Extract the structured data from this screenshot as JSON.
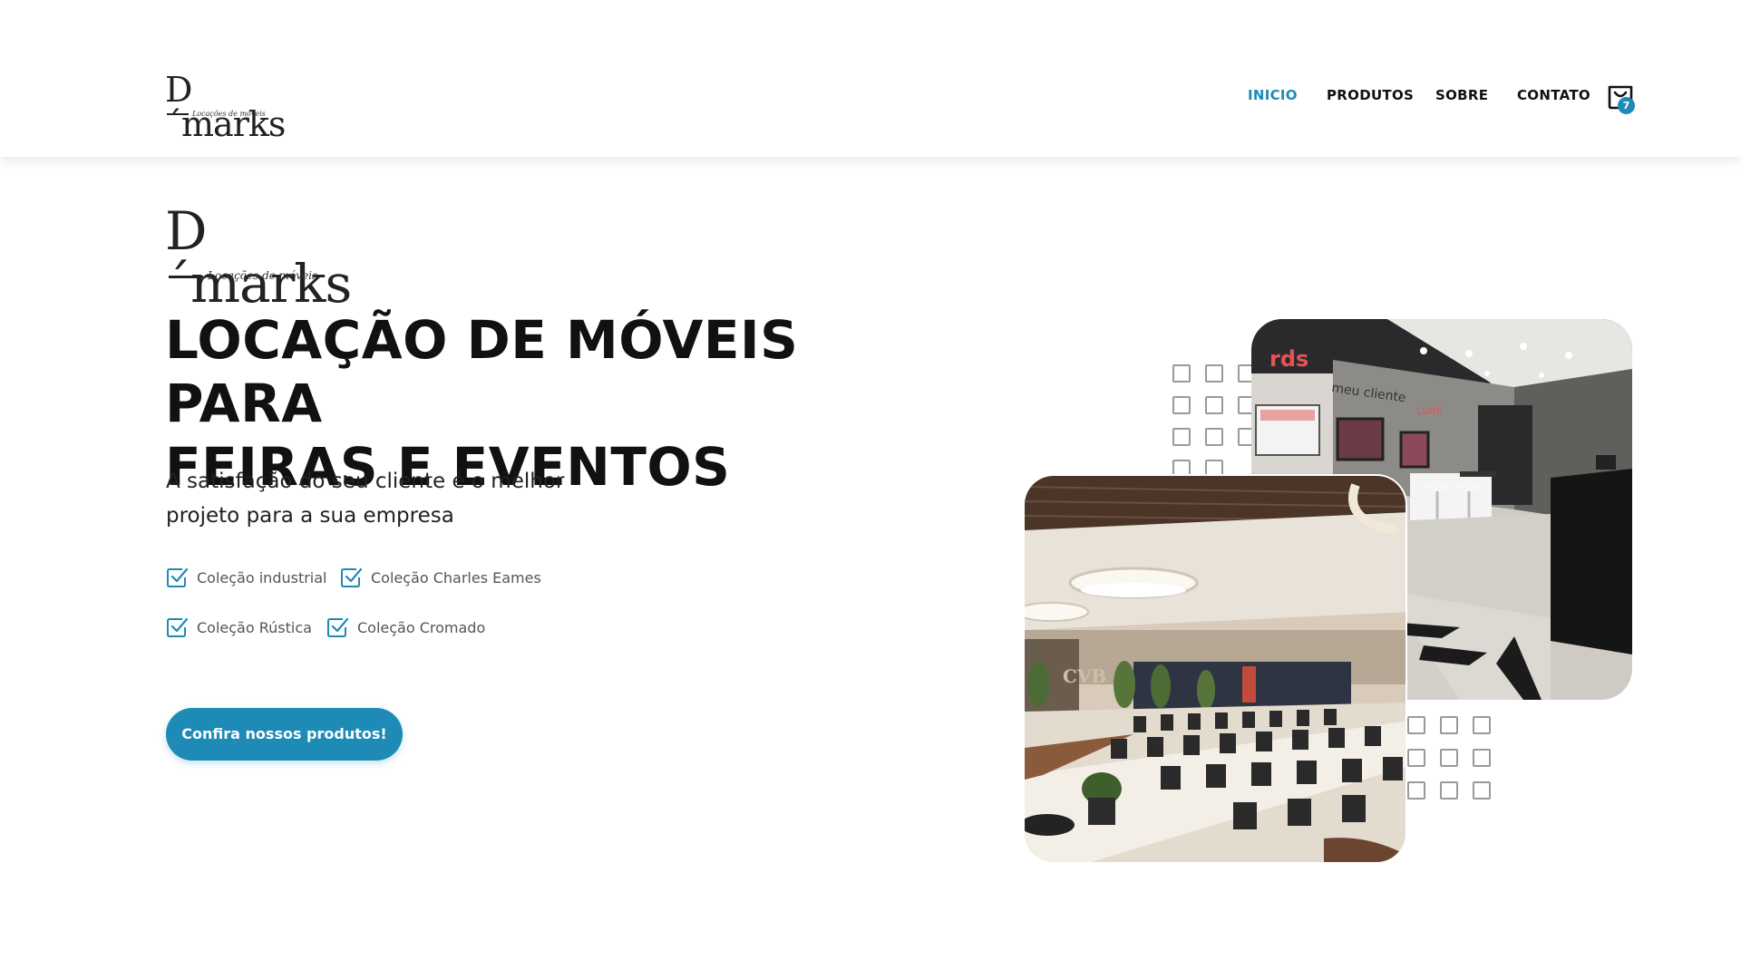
{
  "brand": {
    "logo_text": "D´marks",
    "logo_tagline": "Locações de móveis"
  },
  "nav": {
    "items": [
      {
        "label": "INICIO",
        "active": true
      },
      {
        "label": "PRODUTOS",
        "active": false
      },
      {
        "label": "SOBRE",
        "active": false
      },
      {
        "label": "CONTATO",
        "active": false
      }
    ],
    "cart_count": "7"
  },
  "hero": {
    "title_line1": "LOCAÇÃO DE MÓVEIS PARA",
    "title_line2": "FEIRAS E EVENTOS",
    "subtitle_line1": "A satisfação do seu cliente é o melhor",
    "subtitle_line2": "projeto para a sua empresa",
    "features": [
      "Coleção industrial",
      "Coleção Charles Eames",
      "Coleção Rústica",
      "Coleção Cromado"
    ],
    "cta_label": "Confira nossos produtos!"
  },
  "photos": {
    "booth_signs": [
      "rds",
      "meu cliente",
      "Lumi"
    ],
    "hall_sign": "CVB"
  },
  "colors": {
    "accent": "#1e8ab6",
    "text": "#111111",
    "muted": "#555555"
  }
}
